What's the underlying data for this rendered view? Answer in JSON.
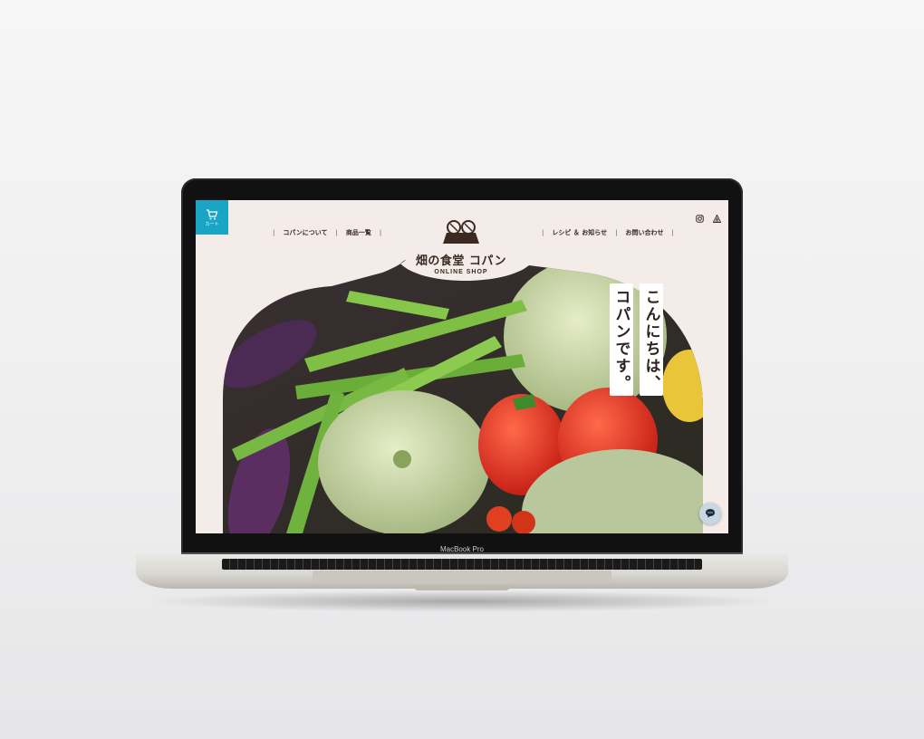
{
  "device": {
    "brand_label": "MacBook Pro"
  },
  "site": {
    "cart_label": "カート",
    "nav_left": [
      {
        "label": "コパンについて"
      },
      {
        "label": "商品一覧"
      }
    ],
    "nav_right": [
      {
        "label": "レシピ ＆ お知らせ"
      },
      {
        "label": "お問い合わせ"
      }
    ],
    "logo": {
      "title": "畑の食堂 コパン",
      "subtitle": "ONLINE SHOP"
    },
    "hero_greeting": {
      "line1": "こんにちは、",
      "line2": "コパンです。"
    },
    "colors": {
      "accent": "#1aa5c4",
      "page_bg": "#f4ece8",
      "text": "#3b2a22"
    },
    "icons": [
      "cart-icon",
      "instagram-icon",
      "tent-icon",
      "chat-icon"
    ]
  }
}
